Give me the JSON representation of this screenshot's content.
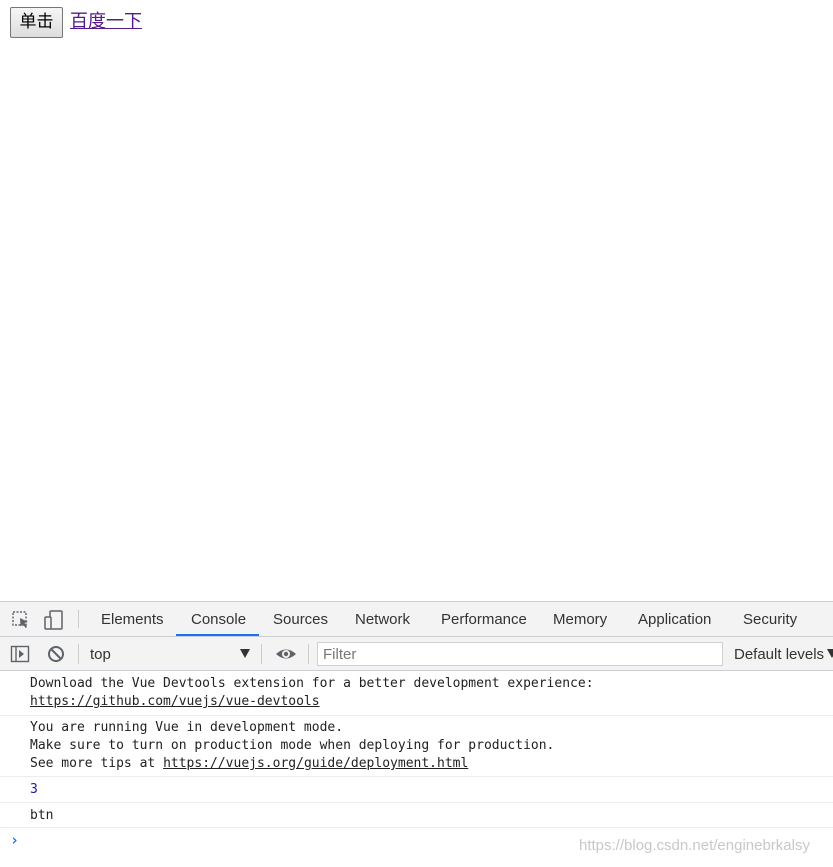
{
  "page": {
    "button_label": "单击",
    "link_text": "百度一下"
  },
  "devtools": {
    "tabs": [
      {
        "label": "Elements"
      },
      {
        "label": "Console"
      },
      {
        "label": "Sources"
      },
      {
        "label": "Network"
      },
      {
        "label": "Performance"
      },
      {
        "label": "Memory"
      },
      {
        "label": "Application"
      },
      {
        "label": "Security"
      }
    ],
    "active_tab": "Console",
    "toolbar": {
      "context": "top",
      "filter_placeholder": "Filter",
      "levels": "Default levels"
    },
    "console": {
      "messages": [
        {
          "line1": "Download the Vue Devtools extension for a better development experience:",
          "link": "https://github.com/vuejs/vue-devtools"
        },
        {
          "line1": "You are running Vue in development mode.",
          "line2": "Make sure to turn on production mode when deploying for production.",
          "line3_prefix": "See more tips at ",
          "link": "https://vuejs.org/guide/deployment.html"
        },
        {
          "text": "3"
        },
        {
          "text": "btn"
        }
      ],
      "prompt": "›"
    },
    "colors": {
      "accent": "#1a73e8",
      "number": "#1a1aa6",
      "visited_link": "#551a8b"
    }
  },
  "watermark": "https://blog.csdn.net/enginebrkalsy"
}
